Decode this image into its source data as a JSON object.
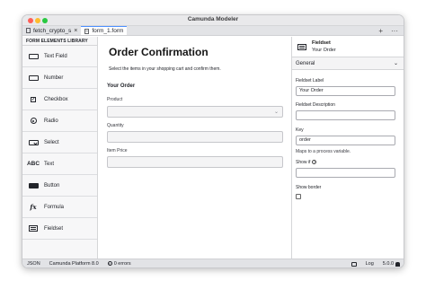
{
  "window": {
    "title": "Camunda Modeler"
  },
  "tabs": [
    {
      "label": "fetch_crypto_s",
      "close": "×"
    },
    {
      "label": "form_1.form",
      "close": "×"
    }
  ],
  "tabbar_actions": {
    "add": "+",
    "more": "···"
  },
  "palette": {
    "title": "FORM ELEMENTS LIBRARY",
    "items": [
      {
        "label": "Text Field",
        "icon": "text-field-icon"
      },
      {
        "label": "Number",
        "icon": "number-icon"
      },
      {
        "label": "Checkbox",
        "icon": "checkbox-icon"
      },
      {
        "label": "Radio",
        "icon": "radio-icon"
      },
      {
        "label": "Select",
        "icon": "select-icon"
      },
      {
        "label": "Text",
        "icon": "text-icon",
        "glyph": "ABC"
      },
      {
        "label": "Button",
        "icon": "button-icon"
      },
      {
        "label": "Formula",
        "icon": "formula-icon",
        "glyph": "fx"
      },
      {
        "label": "Fieldset",
        "icon": "fieldset-icon"
      }
    ]
  },
  "form": {
    "title": "Order Confirmation",
    "description": "Select the items in your shopping cart and confirm them.",
    "fieldset_label": "Your Order",
    "fields": [
      {
        "label": "Product",
        "type": "select"
      },
      {
        "label": "Quantity",
        "type": "number"
      },
      {
        "label": "Item Price",
        "type": "number"
      }
    ]
  },
  "properties": {
    "type": "Fieldset",
    "name": "Your Order",
    "group": "General",
    "fieldset_label_title": "Fieldset Label",
    "fieldset_label_value": "Your Order",
    "fieldset_desc_title": "Fieldset Description",
    "fieldset_desc_value": "",
    "key_title": "Key",
    "key_value": "order",
    "key_hint": "Maps to a process variable.",
    "show_if_title": "Show if",
    "show_if_value": "",
    "show_border_title": "Show border"
  },
  "status": {
    "json": "JSON",
    "platform": "Camunda Platform 8.0",
    "errors": "0 errors",
    "log": "Log",
    "version": "5.0.0"
  }
}
